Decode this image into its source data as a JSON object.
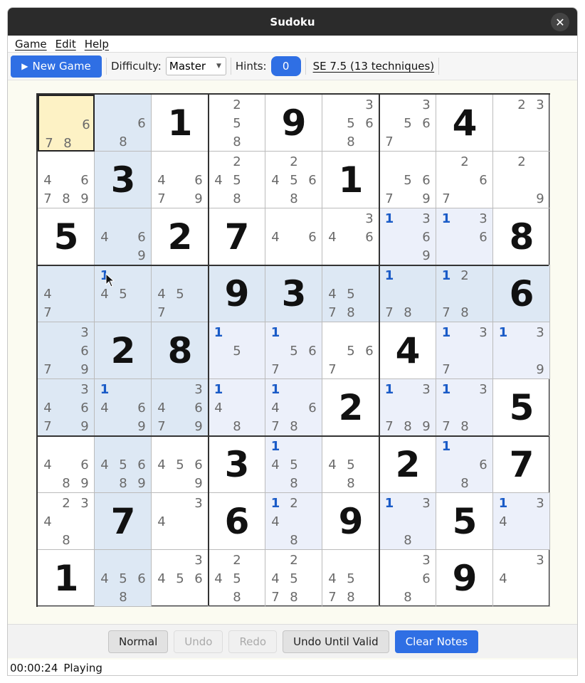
{
  "window": {
    "title": "Sudoku",
    "close_glyph": "✕"
  },
  "menu": {
    "game": "Game",
    "edit": "Edit",
    "help": "Help"
  },
  "toolbar": {
    "new_game": "New Game",
    "difficulty_label": "Difficulty:",
    "difficulty_value": "Master",
    "hints_label": "Hints:",
    "hints_value": "0",
    "se_rating": "SE 7.5 (13 techniques)"
  },
  "grid": {
    "cells": [
      [
        {
          "notes": [
            6,
            7,
            8
          ],
          "sel": true
        },
        {
          "notes": [
            6,
            8
          ],
          "hl": 1
        },
        {
          "v": 1
        },
        {
          "notes": [
            2,
            5,
            8
          ]
        },
        {
          "v": 9
        },
        {
          "notes": [
            3,
            5,
            6,
            8
          ]
        },
        {
          "notes": [
            3,
            5,
            6,
            7
          ]
        },
        {
          "v": 4
        },
        {
          "notes": [
            2,
            3
          ]
        }
      ],
      [
        {
          "notes": [
            4,
            6,
            7,
            8,
            9
          ]
        },
        {
          "v": 3,
          "hl": 1
        },
        {
          "notes": [
            4,
            6,
            7,
            9
          ]
        },
        {
          "notes": [
            2,
            4,
            5,
            8
          ]
        },
        {
          "notes": [
            2,
            4,
            5,
            6,
            8
          ]
        },
        {
          "v": 1
        },
        {
          "notes": [
            5,
            6,
            7,
            9
          ]
        },
        {
          "notes": [
            2,
            6,
            7
          ]
        },
        {
          "notes": [
            2,
            9
          ]
        }
      ],
      [
        {
          "v": 5
        },
        {
          "notes": [
            4,
            6,
            9
          ],
          "hl": 1
        },
        {
          "v": 2
        },
        {
          "v": 7
        },
        {
          "notes": [
            4,
            6
          ]
        },
        {
          "notes": [
            3,
            4,
            6
          ]
        },
        {
          "notes": [
            1,
            3,
            6,
            9
          ],
          "blue": [
            1
          ],
          "hl": 2
        },
        {
          "notes": [
            1,
            3,
            6
          ],
          "blue": [
            1
          ],
          "hl": 2
        },
        {
          "v": 8
        }
      ],
      [
        {
          "notes": [
            4,
            7
          ],
          "hl": 1
        },
        {
          "notes": [
            1,
            4,
            5
          ],
          "blue": [
            1
          ],
          "hl": 3
        },
        {
          "notes": [
            4,
            5,
            7
          ],
          "hl": 1
        },
        {
          "v": 9,
          "hl": 1
        },
        {
          "v": 3,
          "hl": 1
        },
        {
          "notes": [
            4,
            5,
            7,
            8
          ],
          "hl": 1
        },
        {
          "notes": [
            1,
            7,
            8
          ],
          "blue": [
            1
          ],
          "hl": 3
        },
        {
          "notes": [
            1,
            2,
            7,
            8
          ],
          "blue": [
            1
          ],
          "hl": 3
        },
        {
          "v": 6,
          "hl": 1
        }
      ],
      [
        {
          "notes": [
            3,
            6,
            7,
            9
          ],
          "hl": 1
        },
        {
          "v": 2,
          "hl": 1
        },
        {
          "v": 8,
          "hl": 1
        },
        {
          "notes": [
            1,
            5
          ],
          "blue": [
            1
          ],
          "hl": 2
        },
        {
          "notes": [
            1,
            5,
            6,
            7
          ],
          "blue": [
            1
          ],
          "hl": 2
        },
        {
          "notes": [
            5,
            6,
            7
          ]
        },
        {
          "v": 4
        },
        {
          "notes": [
            1,
            3,
            7
          ],
          "blue": [
            1
          ],
          "hl": 2
        },
        {
          "notes": [
            1,
            3,
            9
          ],
          "blue": [
            1
          ],
          "hl": 2
        }
      ],
      [
        {
          "notes": [
            3,
            4,
            6,
            7,
            9
          ],
          "hl": 1
        },
        {
          "notes": [
            1,
            4,
            6,
            9
          ],
          "blue": [
            1
          ],
          "hl": 3
        },
        {
          "notes": [
            3,
            4,
            6,
            7,
            9
          ],
          "hl": 1
        },
        {
          "notes": [
            1,
            4,
            8
          ],
          "blue": [
            1
          ],
          "hl": 2
        },
        {
          "notes": [
            1,
            4,
            6,
            7,
            8
          ],
          "blue": [
            1
          ],
          "hl": 2
        },
        {
          "v": 2
        },
        {
          "notes": [
            1,
            3,
            7,
            8,
            9
          ],
          "blue": [
            1
          ],
          "hl": 2
        },
        {
          "notes": [
            1,
            3,
            7,
            8
          ],
          "blue": [
            1
          ],
          "hl": 2
        },
        {
          "v": 5
        }
      ],
      [
        {
          "notes": [
            4,
            6,
            8,
            9
          ]
        },
        {
          "notes": [
            4,
            5,
            6,
            8,
            9
          ],
          "hl": 1
        },
        {
          "notes": [
            4,
            5,
            6,
            9
          ]
        },
        {
          "v": 3
        },
        {
          "notes": [
            1,
            4,
            5,
            8
          ],
          "blue": [
            1
          ],
          "hl": 2
        },
        {
          "notes": [
            4,
            5,
            8
          ]
        },
        {
          "v": 2
        },
        {
          "notes": [
            1,
            6,
            8
          ],
          "blue": [
            1
          ],
          "hl": 2
        },
        {
          "v": 7
        }
      ],
      [
        {
          "notes": [
            2,
            3,
            4,
            8
          ]
        },
        {
          "v": 7,
          "hl": 1
        },
        {
          "notes": [
            3,
            4
          ]
        },
        {
          "v": 6
        },
        {
          "notes": [
            1,
            2,
            4,
            8
          ],
          "blue": [
            1
          ],
          "hl": 2
        },
        {
          "v": 9
        },
        {
          "notes": [
            1,
            3,
            8
          ],
          "blue": [
            1
          ],
          "hl": 2
        },
        {
          "v": 5
        },
        {
          "notes": [
            1,
            3,
            4
          ],
          "blue": [
            1
          ],
          "hl": 2
        }
      ],
      [
        {
          "v": 1
        },
        {
          "notes": [
            4,
            5,
            6,
            8
          ],
          "hl": 1
        },
        {
          "notes": [
            3,
            4,
            5,
            6
          ]
        },
        {
          "notes": [
            2,
            4,
            5,
            8
          ]
        },
        {
          "notes": [
            2,
            4,
            5,
            7,
            8
          ]
        },
        {
          "notes": [
            4,
            5,
            7,
            8
          ]
        },
        {
          "notes": [
            3,
            6,
            8
          ]
        },
        {
          "v": 9
        },
        {
          "notes": [
            3,
            4
          ]
        }
      ]
    ]
  },
  "bottom": {
    "normal": "Normal",
    "undo": "Undo",
    "redo": "Redo",
    "undo_until_valid": "Undo Until Valid",
    "clear_notes": "Clear Notes"
  },
  "status": {
    "time": "00:00:24",
    "state": "Playing"
  },
  "colors": {
    "accent": "#2f6fe4",
    "note_blue": "#1a5bc7",
    "selected": "#fdf2c5"
  }
}
